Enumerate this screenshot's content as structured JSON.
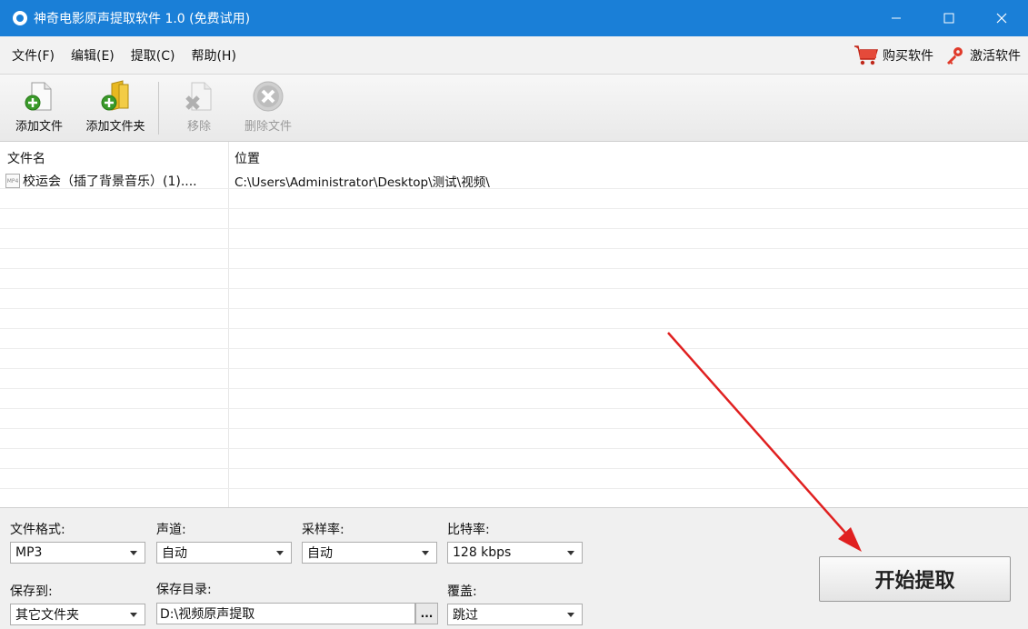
{
  "window": {
    "title": "神奇电影原声提取软件 1.0 (免费试用)"
  },
  "menu": {
    "items": [
      "文件(F)",
      "编辑(E)",
      "提取(C)",
      "帮助(H)"
    ],
    "buy": "购买软件",
    "activate": "激活软件"
  },
  "toolbar": {
    "add_file": "添加文件",
    "add_folder": "添加文件夹",
    "remove": "移除",
    "delete_file": "删除文件"
  },
  "filelist": {
    "columns": [
      "文件名",
      "位置"
    ],
    "rows": [
      {
        "name": "校运会（插了背景音乐）(1)....",
        "path": "C:\\Users\\Administrator\\Desktop\\测试\\视频\\"
      }
    ]
  },
  "settings": {
    "format_label": "文件格式:",
    "format_value": "MP3",
    "channel_label": "声道:",
    "channel_value": "自动",
    "samplerate_label": "采样率:",
    "samplerate_value": "自动",
    "bitrate_label": "比特率:",
    "bitrate_value": "128 kbps",
    "saveto_label": "保存到:",
    "saveto_value": "其它文件夹",
    "savedir_label": "保存目录:",
    "savedir_value": "D:\\视频原声提取",
    "browse": "...",
    "overwrite_label": "覆盖:",
    "overwrite_value": "跳过",
    "start": "开始提取"
  },
  "icons": {
    "app": "app-disc-icon",
    "cart": "cart-icon",
    "key": "key-icon"
  },
  "colors": {
    "titlebar": "#1a7fd7",
    "annotation_arrow": "#e02020"
  }
}
